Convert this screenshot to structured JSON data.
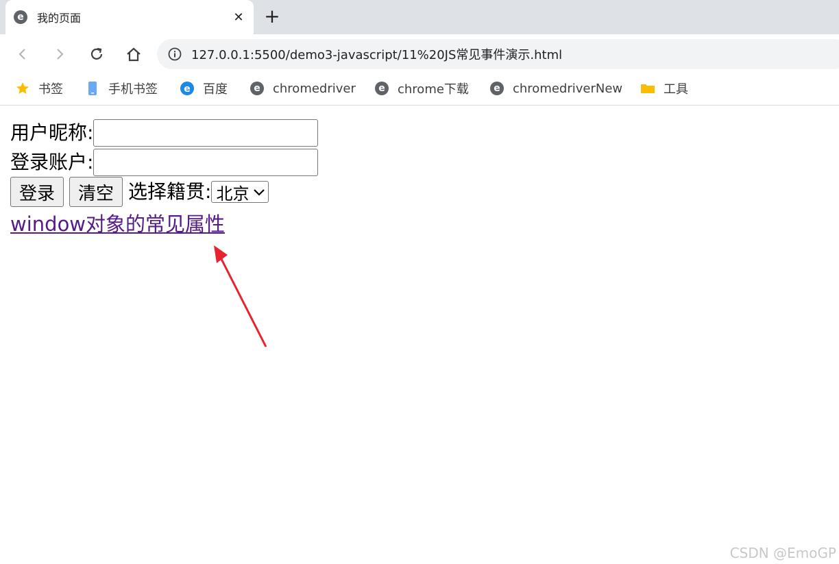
{
  "browser": {
    "tab": {
      "favicon": "e",
      "title": "我的页面",
      "close": "✕"
    },
    "new_tab": "+",
    "address": "127.0.0.1:5500/demo3-javascript/11%20JS常见事件演示.html",
    "bookmarks": [
      {
        "icon": "star-icon",
        "label": "书签"
      },
      {
        "icon": "phone-icon",
        "label": "手机书签"
      },
      {
        "icon": "baidu-icon",
        "label": "百度"
      },
      {
        "icon": "chrome-icon",
        "label": "chromedriver"
      },
      {
        "icon": "chrome-icon",
        "label": "chrome下载"
      },
      {
        "icon": "chrome-icon",
        "label": "chromedriverNew"
      },
      {
        "icon": "folder-icon",
        "label": "工具"
      }
    ]
  },
  "page": {
    "nickname_label": "用户昵称:",
    "nickname_value": "",
    "account_label": "登录账户:",
    "account_value": "",
    "login_button": "登录",
    "clear_button": "清空",
    "origin_label": "选择籍贯:",
    "origin_selected": "北京",
    "window_link": "window对象的常见属性"
  },
  "annotation": {
    "arrow_color": "#e8232f"
  },
  "watermark": "CSDN @EmoGP"
}
